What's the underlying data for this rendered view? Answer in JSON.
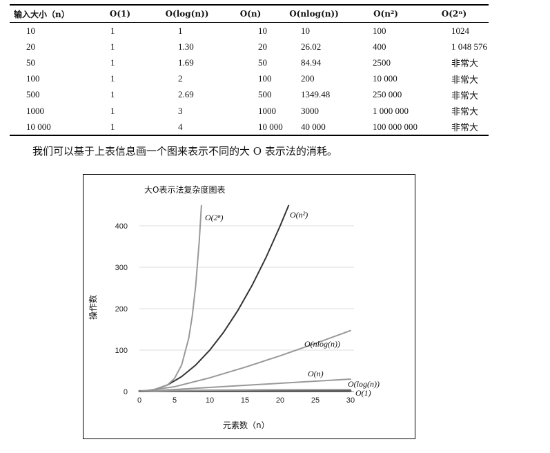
{
  "table": {
    "headers": [
      "输入大小（n）",
      "O(1)",
      "O(log(n))",
      "O(n)",
      "O(nlog(n))",
      "O(n²)",
      "O(2ⁿ)"
    ],
    "rows": [
      [
        "10",
        "1",
        "1",
        "10",
        "10",
        "100",
        "1024"
      ],
      [
        "20",
        "1",
        "1.30",
        "20",
        "26.02",
        "400",
        "1 048 576"
      ],
      [
        "50",
        "1",
        "1.69",
        "50",
        "84.94",
        "2500",
        "非常大"
      ],
      [
        "100",
        "1",
        "2",
        "100",
        "200",
        "10 000",
        "非常大"
      ],
      [
        "500",
        "1",
        "2.69",
        "500",
        "1349.48",
        "250 000",
        "非常大"
      ],
      [
        "1000",
        "1",
        "3",
        "1000",
        "3000",
        "1 000 000",
        "非常大"
      ],
      [
        "10 000",
        "1",
        "4",
        "10 000",
        "40 000",
        "100 000 000",
        "非常大"
      ]
    ]
  },
  "caption": "我们可以基于上表信息画一个图来表示不同的大 O 表示法的消耗。",
  "chart_data": {
    "type": "line",
    "title": "大O表示法复杂度图表",
    "xlabel": "元素数（n）",
    "ylabel": "操作数",
    "xlim": [
      0,
      30
    ],
    "ylim": [
      0,
      450
    ],
    "xticks": [
      0,
      5,
      10,
      15,
      20,
      25,
      30
    ],
    "yticks": [
      0,
      100,
      200,
      300,
      400
    ],
    "grid": true,
    "series": [
      {
        "name": "O(1)",
        "color": "#555555",
        "points": [
          [
            0,
            1
          ],
          [
            30,
            1
          ]
        ]
      },
      {
        "name": "O(log(n))",
        "color": "#999999",
        "points": [
          [
            0,
            0
          ],
          [
            1,
            0
          ],
          [
            5,
            2.3
          ],
          [
            10,
            3.3
          ],
          [
            15,
            3.9
          ],
          [
            20,
            4.3
          ],
          [
            25,
            4.6
          ],
          [
            30,
            4.9
          ]
        ]
      },
      {
        "name": "O(n)",
        "color": "#999999",
        "points": [
          [
            0,
            0
          ],
          [
            5,
            5
          ],
          [
            10,
            10
          ],
          [
            15,
            15
          ],
          [
            20,
            20
          ],
          [
            25,
            25
          ],
          [
            30,
            30
          ]
        ]
      },
      {
        "name": "O(nlog(n))",
        "color": "#999999",
        "points": [
          [
            0,
            0
          ],
          [
            5,
            11.6
          ],
          [
            10,
            33.2
          ],
          [
            15,
            58.6
          ],
          [
            20,
            86.4
          ],
          [
            25,
            116.1
          ],
          [
            30,
            147.2
          ]
        ]
      },
      {
        "name": "O(n²)",
        "color": "#333333",
        "points": [
          [
            0,
            0
          ],
          [
            2,
            4
          ],
          [
            4,
            16
          ],
          [
            6,
            36
          ],
          [
            8,
            64
          ],
          [
            10,
            100
          ],
          [
            12,
            144
          ],
          [
            14,
            196
          ],
          [
            16,
            256
          ],
          [
            18,
            324
          ],
          [
            20,
            400
          ],
          [
            21.2,
            449
          ]
        ]
      },
      {
        "name": "O(2ⁿ)",
        "color": "#999999",
        "points": [
          [
            0,
            1
          ],
          [
            2,
            4
          ],
          [
            4,
            16
          ],
          [
            5,
            32
          ],
          [
            6,
            64
          ],
          [
            7,
            128
          ],
          [
            7.5,
            181
          ],
          [
            8,
            256
          ],
          [
            8.5,
            362
          ],
          [
            8.81,
            449
          ]
        ]
      }
    ]
  }
}
